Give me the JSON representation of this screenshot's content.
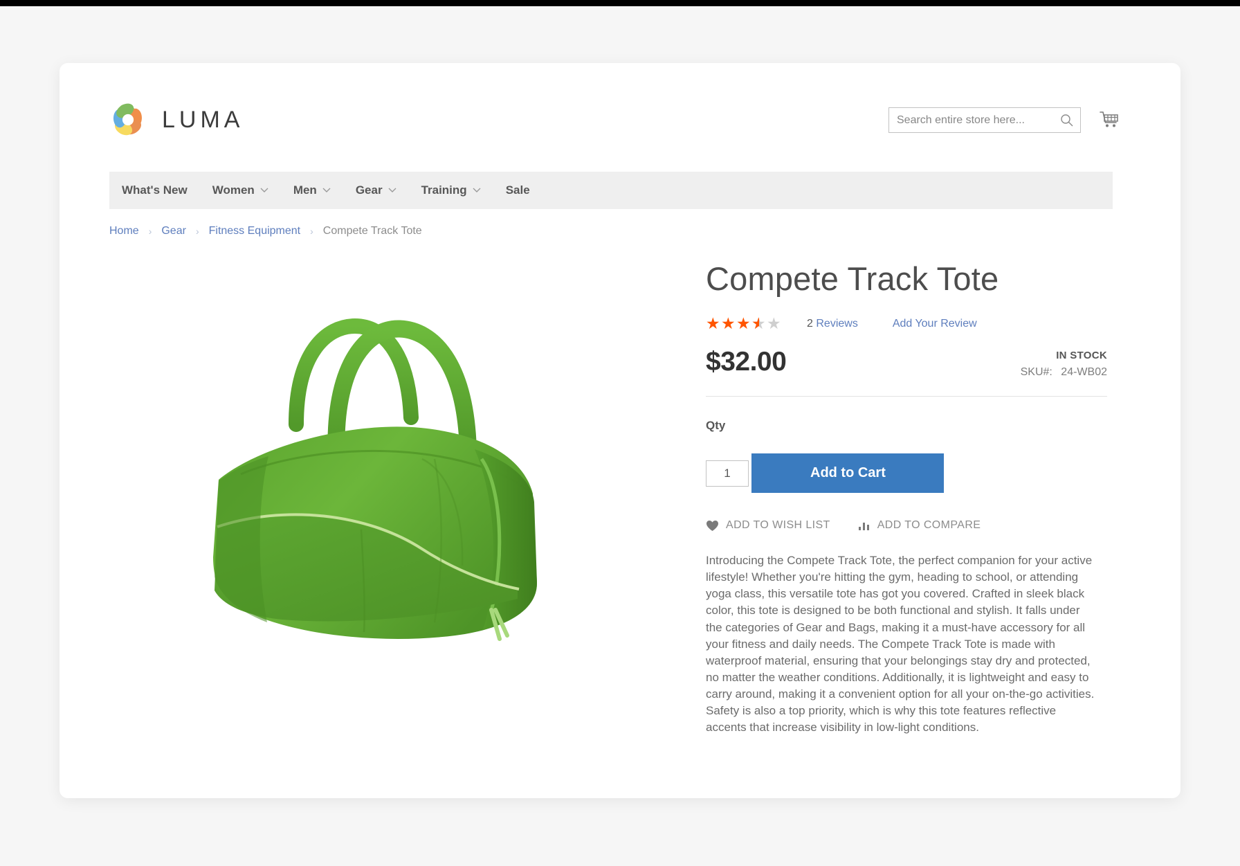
{
  "header": {
    "logo_text": "LUMA",
    "logo_icon": "luma-flower-logo",
    "search": {
      "placeholder": "Search entire store here...",
      "value": "",
      "icon": "search-icon"
    },
    "cart_icon": "shopping-cart-icon"
  },
  "nav": {
    "items": [
      {
        "label": "What's New",
        "has_caret": false
      },
      {
        "label": "Women",
        "has_caret": true
      },
      {
        "label": "Men",
        "has_caret": true
      },
      {
        "label": "Gear",
        "has_caret": true
      },
      {
        "label": "Training",
        "has_caret": true
      },
      {
        "label": "Sale",
        "has_caret": false
      }
    ]
  },
  "breadcrumb": {
    "separator": "›",
    "items": [
      {
        "label": "Home",
        "current": false
      },
      {
        "label": "Gear",
        "current": false
      },
      {
        "label": "Fitness Equipment",
        "current": false
      },
      {
        "label": "Compete Track Tote",
        "current": true
      }
    ]
  },
  "product": {
    "title": "Compete Track Tote",
    "image_alt": "green-duffel-tote-bag",
    "rating": {
      "value": 3.5,
      "max": 5,
      "reviews_count": "2",
      "reviews_label": "Reviews",
      "add_review_label": "Add Your Review"
    },
    "price": "$32.00",
    "stock_status": "IN STOCK",
    "sku_label": "SKU#:",
    "sku_value": "24-WB02",
    "qty_label": "Qty",
    "qty_value": "1",
    "add_to_cart_label": "Add to Cart",
    "wishlist_label": "ADD TO WISH LIST",
    "wishlist_icon": "heart-icon",
    "compare_label": "ADD TO COMPARE",
    "compare_icon": "bar-chart-icon",
    "description": "Introducing the Compete Track Tote, the perfect companion for your active lifestyle! Whether you're hitting the gym, heading to school, or attending yoga class, this versatile tote has got you covered. Crafted in sleek black color, this tote is designed to be both functional and stylish. It falls under the categories of Gear and Bags, making it a must-have accessory for all your fitness and daily needs. The Compete Track Tote is made with waterproof material, ensuring that your belongings stay dry and protected, no matter the weather conditions. Additionally, it is lightweight and easy to carry around, making it a convenient option for all your on-the-go activities. Safety is also a top priority, which is why this tote features reflective accents that increase visibility in low-light conditions."
  },
  "colors": {
    "accent_blue": "#3a7bbf",
    "link_blue": "#5e7ebd",
    "star_orange": "#ff5501",
    "nav_bg": "#efefef",
    "page_bg": "#f6f6f6",
    "bag_green": "#5aa832"
  }
}
